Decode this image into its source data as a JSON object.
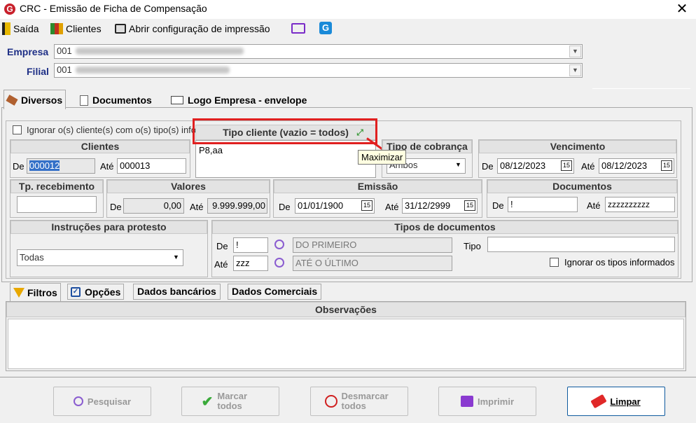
{
  "window": {
    "title": "CRC - Emissão de Ficha de Compensação",
    "logo": "G",
    "close": "✕"
  },
  "toolbar": {
    "saida": "Saída",
    "clientes": "Clientes",
    "abrir_config": "Abrir configuração de impressão"
  },
  "header": {
    "empresa_label": "Empresa",
    "empresa_value": "001",
    "filial_label": "Filial",
    "filial_value": "001"
  },
  "tabs": {
    "diversos": "Diversos",
    "documentos": "Documentos",
    "logo": "Logo Empresa - envelope"
  },
  "ignorar_clientes": "Ignorar o(s) cliente(s) com o(s) tipo(s) info",
  "tipo_cliente": {
    "title": "Tipo cliente (vazio = todos)",
    "value": "P8,aa",
    "tooltip": "Maximizar"
  },
  "clientes": {
    "title": "Clientes",
    "de_label": "De",
    "de_value": "000012",
    "ate_label": "Até",
    "ate_value": "000013"
  },
  "tipo_cobranca": {
    "title": "Tipo de cobrança",
    "value": "Ambos"
  },
  "vencimento": {
    "title": "Vencimento",
    "de_label": "De",
    "de_value": "08/12/2023",
    "ate_label": "Até",
    "ate_value": "08/12/2023"
  },
  "tp_recebimento": {
    "title": "Tp. recebimento",
    "value": ""
  },
  "valores": {
    "title": "Valores",
    "de_label": "De",
    "de_value": "0,00",
    "ate_label": "Até",
    "ate_value": "9.999.999,00"
  },
  "emissao": {
    "title": "Emissão",
    "de_label": "De",
    "de_value": "01/01/1900",
    "ate_label": "Até",
    "ate_value": "31/12/2999"
  },
  "documentos": {
    "title": "Documentos",
    "de_label": "De",
    "de_value": "!",
    "ate_label": "Até",
    "ate_value": "zzzzzzzzzz"
  },
  "instrucoes": {
    "title": "Instruções para protesto",
    "value": "Todas"
  },
  "tipos_doc": {
    "title": "Tipos de documentos",
    "de_label": "De",
    "de_value": "!",
    "de_desc": "DO PRIMEIRO",
    "ate_label": "Até",
    "ate_value": "zzz",
    "ate_desc": "ATÉ O ÚLTIMO",
    "tipo_label": "Tipo",
    "tipo_value": "",
    "ignorar": "Ignorar os tipos informados"
  },
  "subtabs": {
    "filtros": "Filtros",
    "opcoes": "Opções",
    "bancarios": "Dados bancários",
    "comerciais": "Dados Comerciais"
  },
  "observacoes": {
    "title": "Observações",
    "value": ""
  },
  "buttons": {
    "pesquisar": "Pesquisar",
    "marcar": "Marcar todos",
    "desmarcar": "Desmarcar todos",
    "imprimir": "Imprimir",
    "limpar": "Limpar"
  },
  "colors": {
    "label_blue": "#1e2f86",
    "highlight_red": "#e02020",
    "selection": "#3470c8"
  }
}
